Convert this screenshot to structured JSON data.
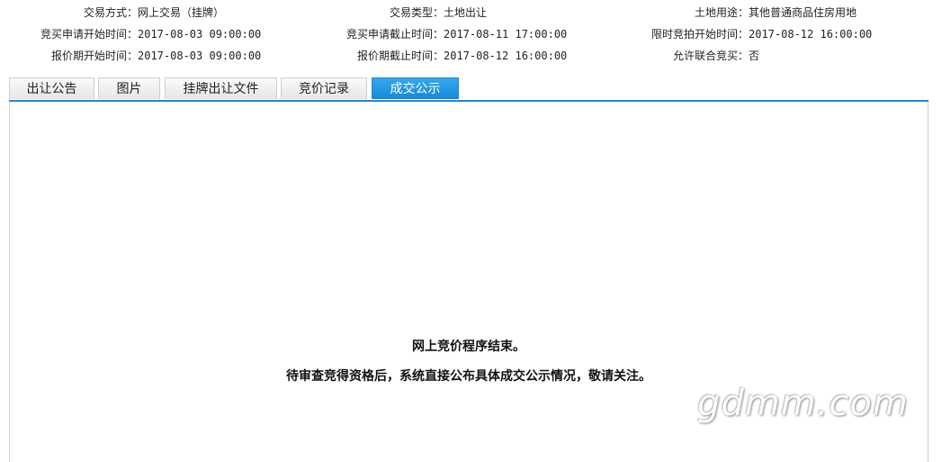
{
  "info": {
    "rows": [
      [
        {
          "label": "交易方式：",
          "value": "网上交易（挂牌）"
        },
        {
          "label": "交易类型：",
          "value": "土地出让"
        },
        {
          "label": "土地用途：",
          "value": "其他普通商品住房用地"
        }
      ],
      [
        {
          "label": "竞买申请开始时间：",
          "value": "2017-08-03 09:00:00"
        },
        {
          "label": "竞买申请截止时间：",
          "value": "2017-08-11 17:00:00"
        },
        {
          "label": "限时竞拍开始时间：",
          "value": "2017-08-12 16:00:00"
        }
      ],
      [
        {
          "label": "报价期开始时间：",
          "value": "2017-08-03 09:00:00"
        },
        {
          "label": "报价期截止时间：",
          "value": "2017-08-12 16:00:00"
        },
        {
          "label": "允许联合竞买：",
          "value": "否"
        }
      ]
    ]
  },
  "tabs": [
    {
      "label": "出让公告",
      "active": false
    },
    {
      "label": "图片",
      "active": false
    },
    {
      "label": "挂牌出让文件",
      "active": false
    },
    {
      "label": "竞价记录",
      "active": false
    },
    {
      "label": "成交公示",
      "active": true
    }
  ],
  "panel": {
    "line1": "网上竞价程序结束。",
    "line2": "待审查竞得资格后，系统直接公布具体成交公示情况，敬请关注。"
  },
  "watermark": "gdmm.com",
  "colors": {
    "tab_active": "#1887d8",
    "tab_line": "#1f86d4"
  }
}
